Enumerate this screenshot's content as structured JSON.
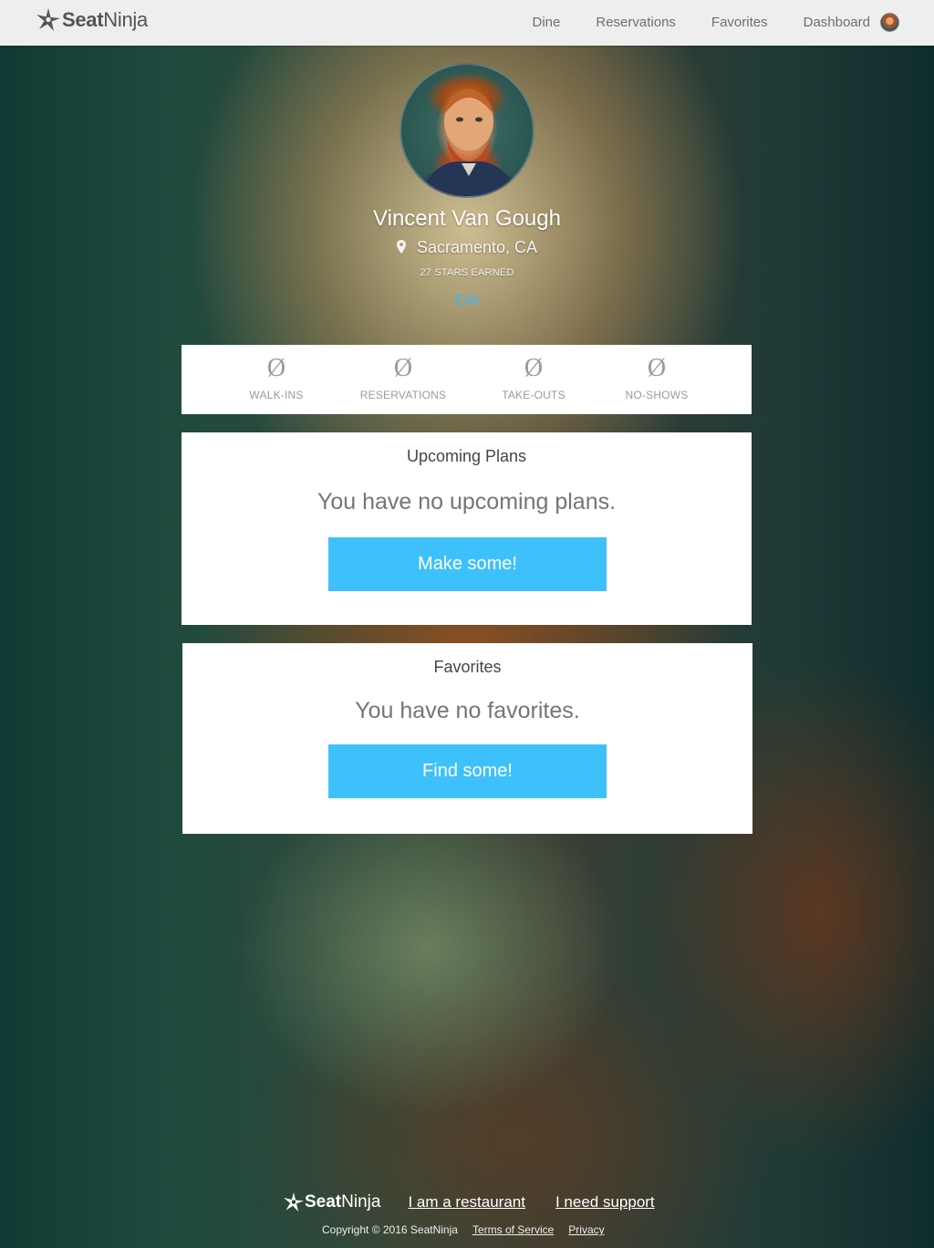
{
  "brand": {
    "name_bold": "Seat",
    "name_light": "Ninja",
    "logo_icon": "ninja-star-icon"
  },
  "nav": {
    "links": [
      "Dine",
      "Reservations",
      "Favorites",
      "Dashboard"
    ],
    "avatar_icon": "user-avatar"
  },
  "profile": {
    "name": "Vincent Van Gough",
    "location": "Sacramento, CA",
    "location_icon": "map-pin-icon",
    "stars": "27 STARS EARNED",
    "edit_label": "Edit"
  },
  "stats": [
    {
      "value": "Ø",
      "label": "WALK-INS"
    },
    {
      "value": "Ø",
      "label": "RESERVATIONS"
    },
    {
      "value": "Ø",
      "label": "TAKE-OUTS"
    },
    {
      "value": "Ø",
      "label": "NO-SHOWS"
    }
  ],
  "upcoming": {
    "title": "Upcoming Plans",
    "message": "You have no upcoming plans.",
    "button": "Make some!"
  },
  "favorites": {
    "title": "Favorites",
    "message": "You have no favorites.",
    "button": "Find some!"
  },
  "footer": {
    "links": [
      "I am a restaurant",
      "I need support"
    ],
    "copyright": "Copyright © 2016 SeatNinja",
    "small_links": [
      "Terms of Service",
      "Privacy"
    ]
  },
  "colors": {
    "accent": "#3ec1fb",
    "link": "#42b5e8",
    "nav_bg": "#eeeeee"
  }
}
